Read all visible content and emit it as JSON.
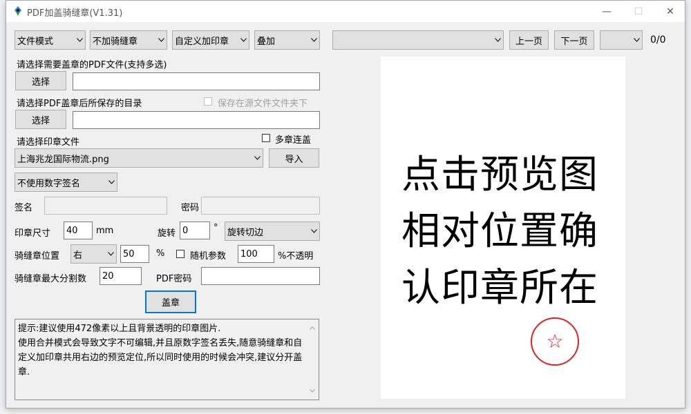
{
  "window": {
    "title": "PDF加盖骑缝章(V1.31)",
    "minimize": "—",
    "maximize": "☐",
    "close": "✕"
  },
  "toolbar": {
    "mode": "文件模式",
    "seam_mode": "不加骑缝章",
    "custom_stamp": "自定义加印章",
    "overlay": "叠加",
    "file_select_value": "",
    "prev_page": "上一页",
    "next_page": "下一页",
    "page_select_value": "",
    "page_counter": "0/0"
  },
  "pdf_select": {
    "label": "请选择需要盖章的PDF文件(支持多选)",
    "button": "选择",
    "path": ""
  },
  "save_dir": {
    "label": "请选择PDF盖章后所保存的目录",
    "save_in_source_label": "保存在源文件文件夹下",
    "save_in_source_checked": false,
    "button": "选择",
    "path": ""
  },
  "stamp_file": {
    "label": "请选择印章文件",
    "multi_overlap_label": "多章连盖",
    "multi_overlap_checked": false,
    "selected": "上海兆龙国际物流.png",
    "import_button": "导入"
  },
  "digital_signature": {
    "selected": "不使用数字签名",
    "sign_label": "签名",
    "sign_value": "",
    "password_label": "密码",
    "password_value": ""
  },
  "stamp_size": {
    "label": "印章尺寸",
    "value": "40",
    "unit": "mm",
    "rotate_label": "旋转",
    "rotate_value": "0",
    "degree_symbol": "°",
    "rotate_mode": "旋转切边"
  },
  "seam_position": {
    "label": "骑缝章位置",
    "side": "右",
    "percent_value": "50",
    "percent_symbol": "%",
    "random_label": "随机参数",
    "random_checked": false,
    "opacity_value": "100",
    "opacity_label": "%不透明"
  },
  "seam_max": {
    "label": "骑缝章最大分割数",
    "value": "20",
    "pdf_password_label": "PDF密码",
    "pdf_password_value": ""
  },
  "stamp_button": "盖章",
  "hint": "提示:建议使用472像素以上且背景透明的印章图片.\n使用合并模式会导致文字不可编辑,并且原数字签名丢失,随意骑缝章和自定义加印章共用右边的预览定位,所以同时使用的时候会冲突,建议分开盖章.",
  "preview": {
    "lines": [
      "点击预览图",
      "相对位置确",
      "认印章所在"
    ],
    "stamp_glyph": "☆",
    "stamp_color": "#e02020"
  }
}
